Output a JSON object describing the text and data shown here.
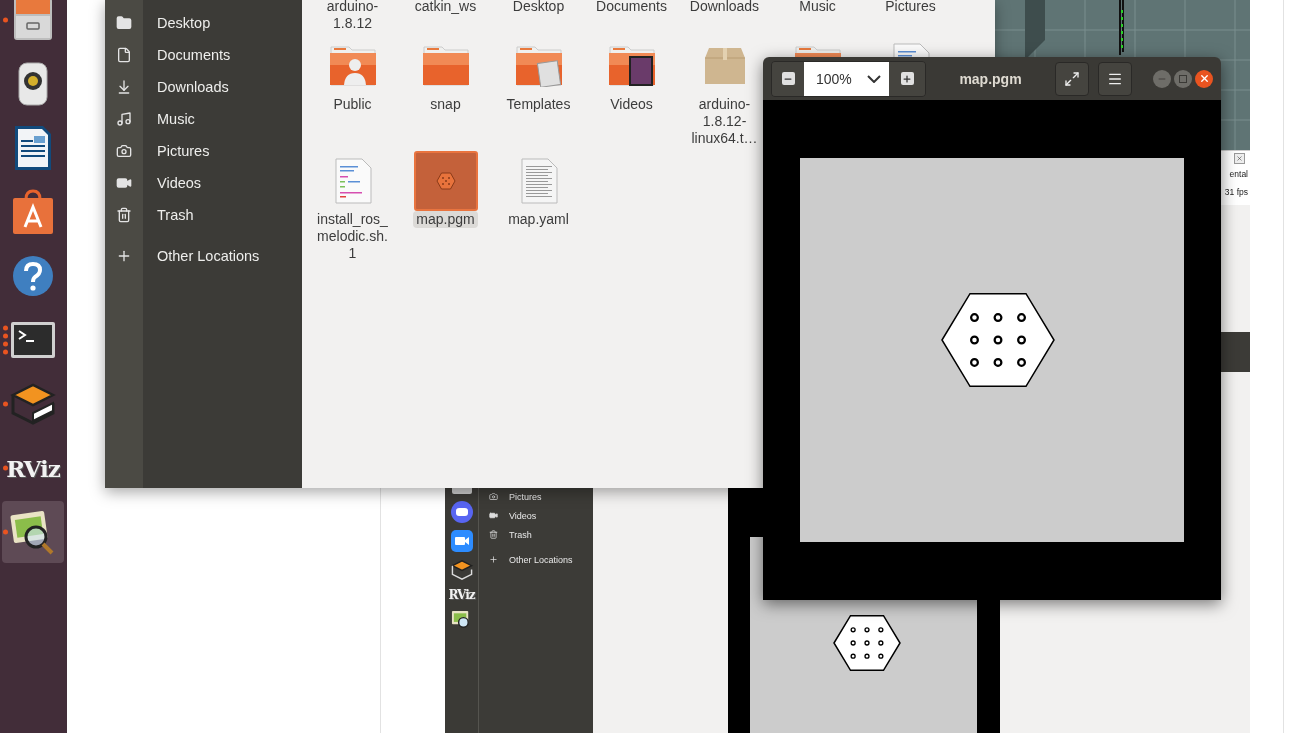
{
  "dock": {
    "items": [
      {
        "kind": "file-cabinet",
        "running": true,
        "multiple_windows": false,
        "selected": false
      },
      {
        "kind": "speaker",
        "running": false,
        "multiple_windows": false,
        "selected": false
      },
      {
        "kind": "writer",
        "running": false,
        "multiple_windows": false,
        "selected": false
      },
      {
        "kind": "software",
        "running": false,
        "multiple_windows": false,
        "selected": false
      },
      {
        "kind": "help",
        "running": false,
        "multiple_windows": false,
        "selected": false
      },
      {
        "kind": "terminal",
        "running": true,
        "multiple_windows": true,
        "selected": false
      },
      {
        "kind": "box",
        "running": true,
        "multiple_windows": false,
        "selected": false
      },
      {
        "kind": "rviz",
        "label": "RViz",
        "running": true,
        "multiple_windows": false,
        "selected": false
      },
      {
        "kind": "image-viewer",
        "running": true,
        "multiple_windows": false,
        "selected": true
      }
    ]
  },
  "files_window": {
    "sidebar": {
      "items": [
        {
          "kind": "folder",
          "label": "Desktop"
        },
        {
          "kind": "document",
          "label": "Documents"
        },
        {
          "kind": "download",
          "label": "Downloads"
        },
        {
          "kind": "music",
          "label": "Music"
        },
        {
          "kind": "camera",
          "label": "Pictures"
        },
        {
          "kind": "video",
          "label": "Videos"
        },
        {
          "kind": "trash",
          "label": "Trash"
        },
        {
          "kind": "plus",
          "label": "Other Locations"
        }
      ]
    },
    "grid": {
      "rows": [
        [
          {
            "kind": "label-only",
            "label": "arduino-1.8.12",
            "selected": false
          },
          {
            "kind": "label-only",
            "label": "catkin_ws",
            "selected": false
          },
          {
            "kind": "label-only",
            "label": "Desktop",
            "selected": false
          },
          {
            "kind": "label-only",
            "label": "Documents",
            "selected": false
          },
          {
            "kind": "label-only",
            "label": "Downloads",
            "selected": false
          },
          {
            "kind": "label-only",
            "label": "Music",
            "selected": false
          },
          {
            "kind": "label-only",
            "label": "Pictures",
            "selected": false
          }
        ],
        [
          {
            "kind": "folder-user",
            "label": "Public",
            "selected": false
          },
          {
            "kind": "folder",
            "label": "snap",
            "selected": false
          },
          {
            "kind": "folder-templates",
            "label": "Templates",
            "selected": false
          },
          {
            "kind": "folder-videos",
            "label": "Videos",
            "selected": false
          },
          {
            "kind": "package",
            "label": "arduino-1.8.12-linux64.t…",
            "selected": false
          },
          {
            "kind": "folder",
            "selected": false
          },
          {
            "kind": "script",
            "selected": false
          }
        ],
        [
          {
            "kind": "script",
            "label": "install_ros_melodic.sh.1",
            "selected": false
          },
          {
            "kind": "image",
            "label": "map.pgm",
            "selected": true
          },
          {
            "kind": "text",
            "label": "map.yaml",
            "selected": false
          }
        ]
      ]
    }
  },
  "viewer_window": {
    "zoom": "100%",
    "title": "map.pgm"
  },
  "background": {
    "screenshot": {
      "dock_items": [
        {
          "kind": "partial"
        },
        {
          "kind": "chat"
        },
        {
          "kind": "camera"
        },
        {
          "kind": "box"
        },
        {
          "kind": "rviz",
          "label": "RViz"
        },
        {
          "kind": "image-viewer"
        }
      ],
      "sidebar_items": [
        {
          "kind": "camera",
          "label": "Pictures"
        },
        {
          "kind": "video",
          "label": "Videos"
        },
        {
          "kind": "trash",
          "label": "Trash"
        },
        {
          "kind": "plus",
          "label": "Other Locations"
        }
      ],
      "panel_texts": [
        "ental",
        "31 fps"
      ]
    }
  }
}
